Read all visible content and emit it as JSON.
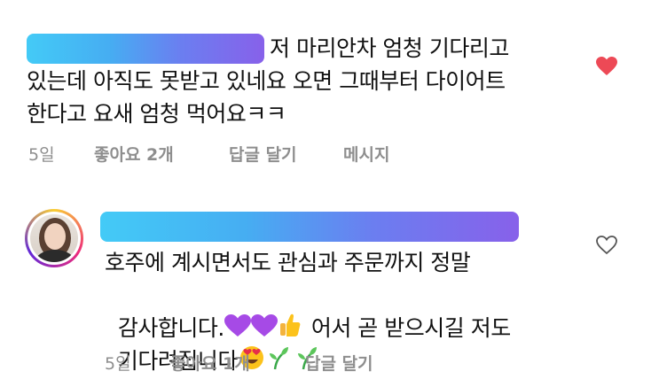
{
  "comment1": {
    "lines": [
      "저 마리안차 엄청 기다리고",
      "있는데 아직도 못받고 있네요 오면 그때부터 다이어트",
      "한다고 요새 엄청 먹어요ㅋㅋ"
    ],
    "meta": {
      "time": "5일",
      "likes": "좋아요 2개",
      "reply": "답글 달기",
      "message": "메시지"
    },
    "liked": true,
    "heart_color": "#ed4956"
  },
  "comment2": {
    "lines": [
      "호주에 계시면서도 관심과 주문까지 정말",
      "감사합니다.",
      "어서 곧 받으시길 저도",
      "기다려집니다"
    ],
    "meta": {
      "time": "5일",
      "likes": "좋아요 1개",
      "reply": "답글 달기"
    },
    "liked": false,
    "emoji": [
      "purple-heart",
      "purple-heart",
      "thumbs-up",
      "heart-eyes",
      "seedling",
      "seedling"
    ]
  }
}
